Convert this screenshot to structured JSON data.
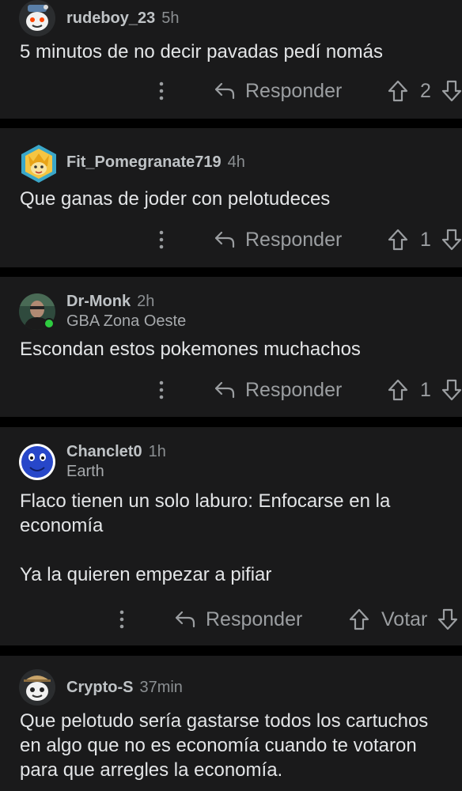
{
  "labels": {
    "reply": "Responder"
  },
  "comments": [
    {
      "username": "rudeboy_23",
      "time": "5h",
      "flair": "",
      "text": "5 minutos de no decir pavadas pedí nomás",
      "score": "2",
      "avatar_icon": "snoo-avatar-icon"
    },
    {
      "username": "Fit_Pomegranate719",
      "time": "4h",
      "flair": "",
      "text": "Que ganas de joder con pelotudeces",
      "score": "1",
      "avatar_icon": "pokemon-avatar-icon"
    },
    {
      "username": "Dr-Monk",
      "time": "2h",
      "flair": "GBA Zona Oeste",
      "text": "Escondan estos pokemones muchachos",
      "score": "1",
      "avatar_icon": "photo-avatar-icon",
      "online": true
    },
    {
      "username": "Chanclet0",
      "time": "1h",
      "flair": "Earth",
      "text": "Flaco tienen un solo laburo: Enfocarse en la economía\n\nYa la quieren empezar a pifiar",
      "score": "Votar",
      "avatar_icon": "blue-face-avatar-icon"
    },
    {
      "username": "Crypto-S",
      "time": "37min",
      "flair": "",
      "text": "Que pelotudo sería gastarse todos los cartuchos en algo que no es economía cuando te votaron para que arregles la economía.",
      "avatar_icon": "snoo-avatar-icon"
    }
  ],
  "colors": {
    "page_bg": "#000000",
    "card_bg": "#1a1a1b",
    "text": "#e3e5e7",
    "meta": "#8b8f92",
    "online": "#2ecc40"
  }
}
